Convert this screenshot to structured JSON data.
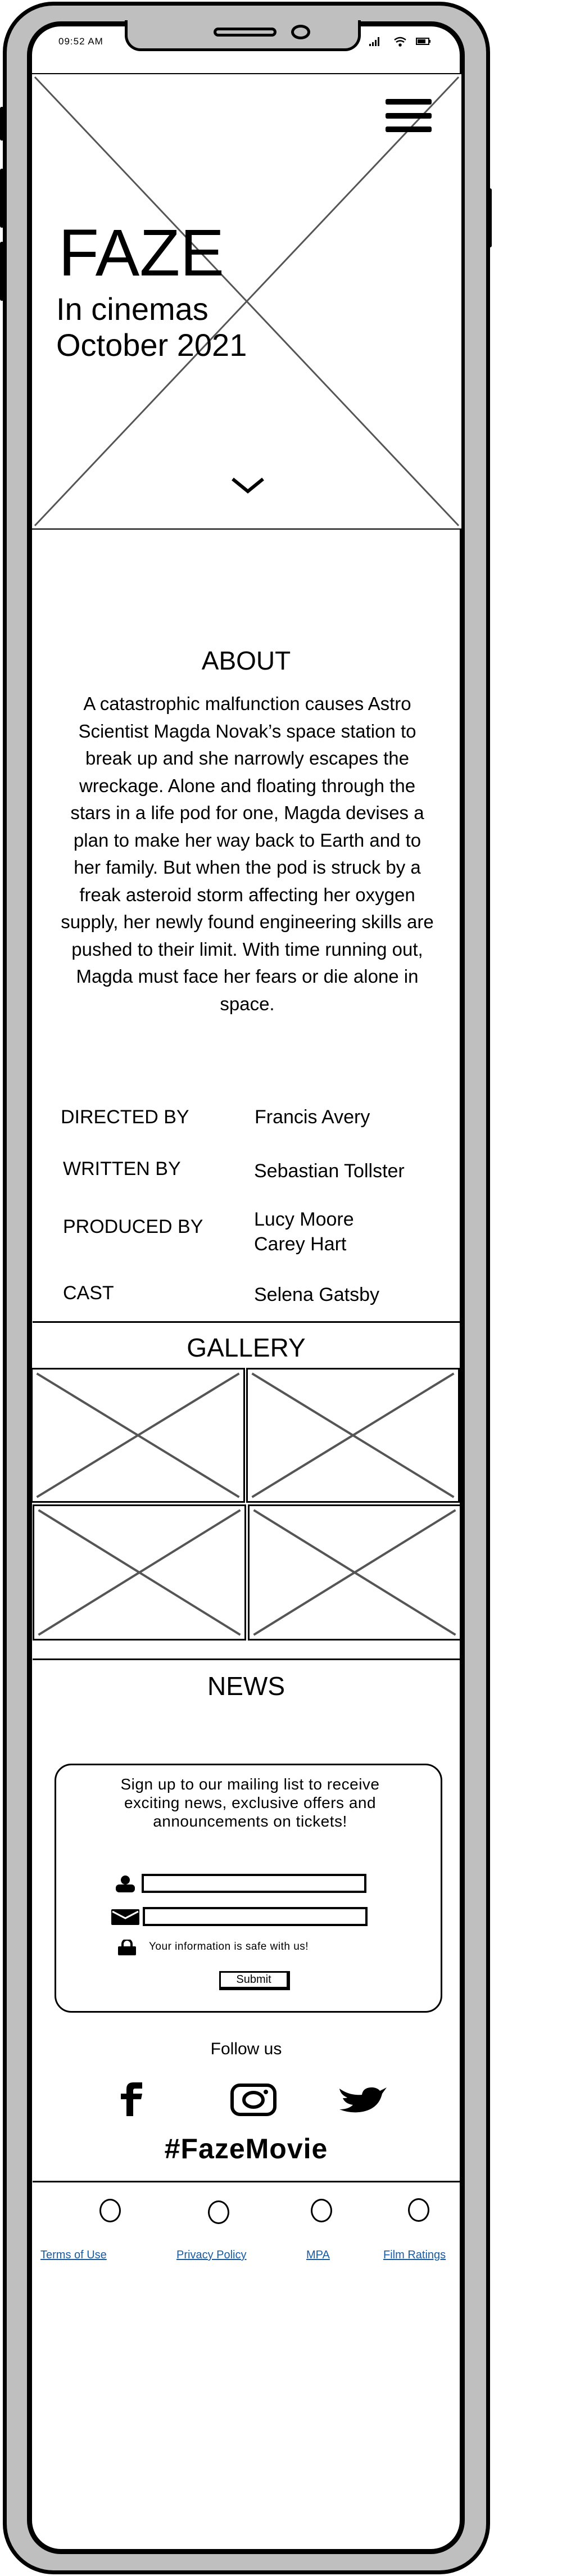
{
  "status_bar": {
    "time": "09:52 AM",
    "icons": [
      "signal-icon",
      "wifi-icon",
      "battery-icon"
    ]
  },
  "hero": {
    "title": "FAZE",
    "subtitle_line1": "In cinemas",
    "subtitle_line2": "October 2021",
    "menu_icon": "hamburger-menu-icon",
    "scroll_icon": "chevron-down-icon"
  },
  "about": {
    "heading": "ABOUT",
    "synopsis": "A catastrophic malfunction causes Astro Scientist Magda Novak’s space station to break up and she narrowly escapes the wreckage. Alone and floating through the stars in a life pod for one, Magda devises a plan to make her way back to Earth and to her family. But when the pod is struck by a freak asteroid storm affecting her oxygen supply, her newly found engineering skills are pushed to their limit. With time running out, Magda must face her fears or die alone in space.",
    "credits": [
      {
        "label": "DIRECTED BY",
        "values": [
          "Francis Avery"
        ]
      },
      {
        "label": "WRITTEN BY",
        "values": [
          "Sebastian Tollster"
        ]
      },
      {
        "label": "PRODUCED BY",
        "values": [
          "Lucy Moore",
          "Carey Hart"
        ]
      },
      {
        "label": "CAST",
        "values": [
          "Selena Gatsby"
        ]
      }
    ]
  },
  "gallery": {
    "heading": "GALLERY"
  },
  "news": {
    "heading": "NEWS",
    "signup_text": "Sign up to our mailing list to receive exciting news, exclusive offers and announcements on tickets!",
    "name_value": "",
    "email_value": "",
    "privacy_note": "Your information is safe with us!",
    "submit_label": "Submit"
  },
  "social": {
    "heading": "Follow us",
    "icons": [
      "facebook-icon",
      "instagram-icon",
      "twitter-icon"
    ],
    "hashtag": "#FazeMovie"
  },
  "footer": {
    "links": [
      "Terms of Use",
      "Privacy Policy",
      "MPA",
      "Film Ratings"
    ],
    "link_color": "#1a5aa0"
  }
}
